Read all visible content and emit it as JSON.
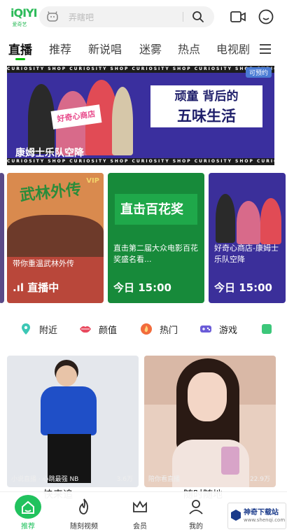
{
  "header": {
    "logo_text": "iQIYI",
    "logo_sub": "爱奇艺",
    "search_placeholder": "弄瞎吧"
  },
  "tabs": [
    "直播",
    "推荐",
    "新说唱",
    "迷雾",
    "热点",
    "电视剧"
  ],
  "banner": {
    "headline_line1": "顽童 背后的",
    "headline_line2": "五味生活",
    "caption": "康姆士乐队空降",
    "corner_badge": "可预约",
    "stripe_text": "CURIOSITY SHOP  CURIOSITY SHOP  CURIOSITY SHOP  CURIOSITY SHOP  CURIOSITY SHOP",
    "sign_text": "好奇心商店"
  },
  "live_cards": [
    {
      "title_art": "武林外传",
      "vip": "VIP",
      "desc": "带你重温武林外传",
      "meta": ".ıl 直播中"
    },
    {
      "title_art": "直击百花奖",
      "desc": "直击第二届大众电影百花奖盛名看...",
      "meta": "今日 15:00"
    },
    {
      "title_art": "好奇心商店",
      "desc": "好奇心商店-康姆士乐队空降",
      "meta": "今日 15:00"
    }
  ],
  "categories": [
    {
      "label": "附近",
      "icon": "location-icon",
      "color": "#3cc7b5"
    },
    {
      "label": "颜值",
      "icon": "lips-icon",
      "color": "#e8495e"
    },
    {
      "label": "热门",
      "icon": "fire-icon",
      "color": "#f26c3c"
    },
    {
      "label": "游戏",
      "icon": "gamepad-icon",
      "color": "#6a5bd8"
    }
  ],
  "grid_cards": [
    {
      "left": "小说直播 · 心跳最强 NB",
      "right": "3.6万",
      "title": "快来追"
    },
    {
      "left": "陪你看直播",
      "right": "22.9万",
      "title": "随时随地"
    }
  ],
  "bottom_nav": [
    {
      "label": "推荐",
      "icon": "home-icon"
    },
    {
      "label": "随刻视频",
      "icon": "flame-icon"
    },
    {
      "label": "会员",
      "icon": "crown-icon"
    },
    {
      "label": "我的",
      "icon": "profile-icon"
    }
  ],
  "watermark": {
    "title": "神奇下载站",
    "url": "www.shenqi.com"
  },
  "colors": {
    "accent": "#00be06",
    "banner_bg": "#3a2f9e",
    "card2_bg": "#178a3a",
    "card3_bg": "#3b2f9a"
  }
}
